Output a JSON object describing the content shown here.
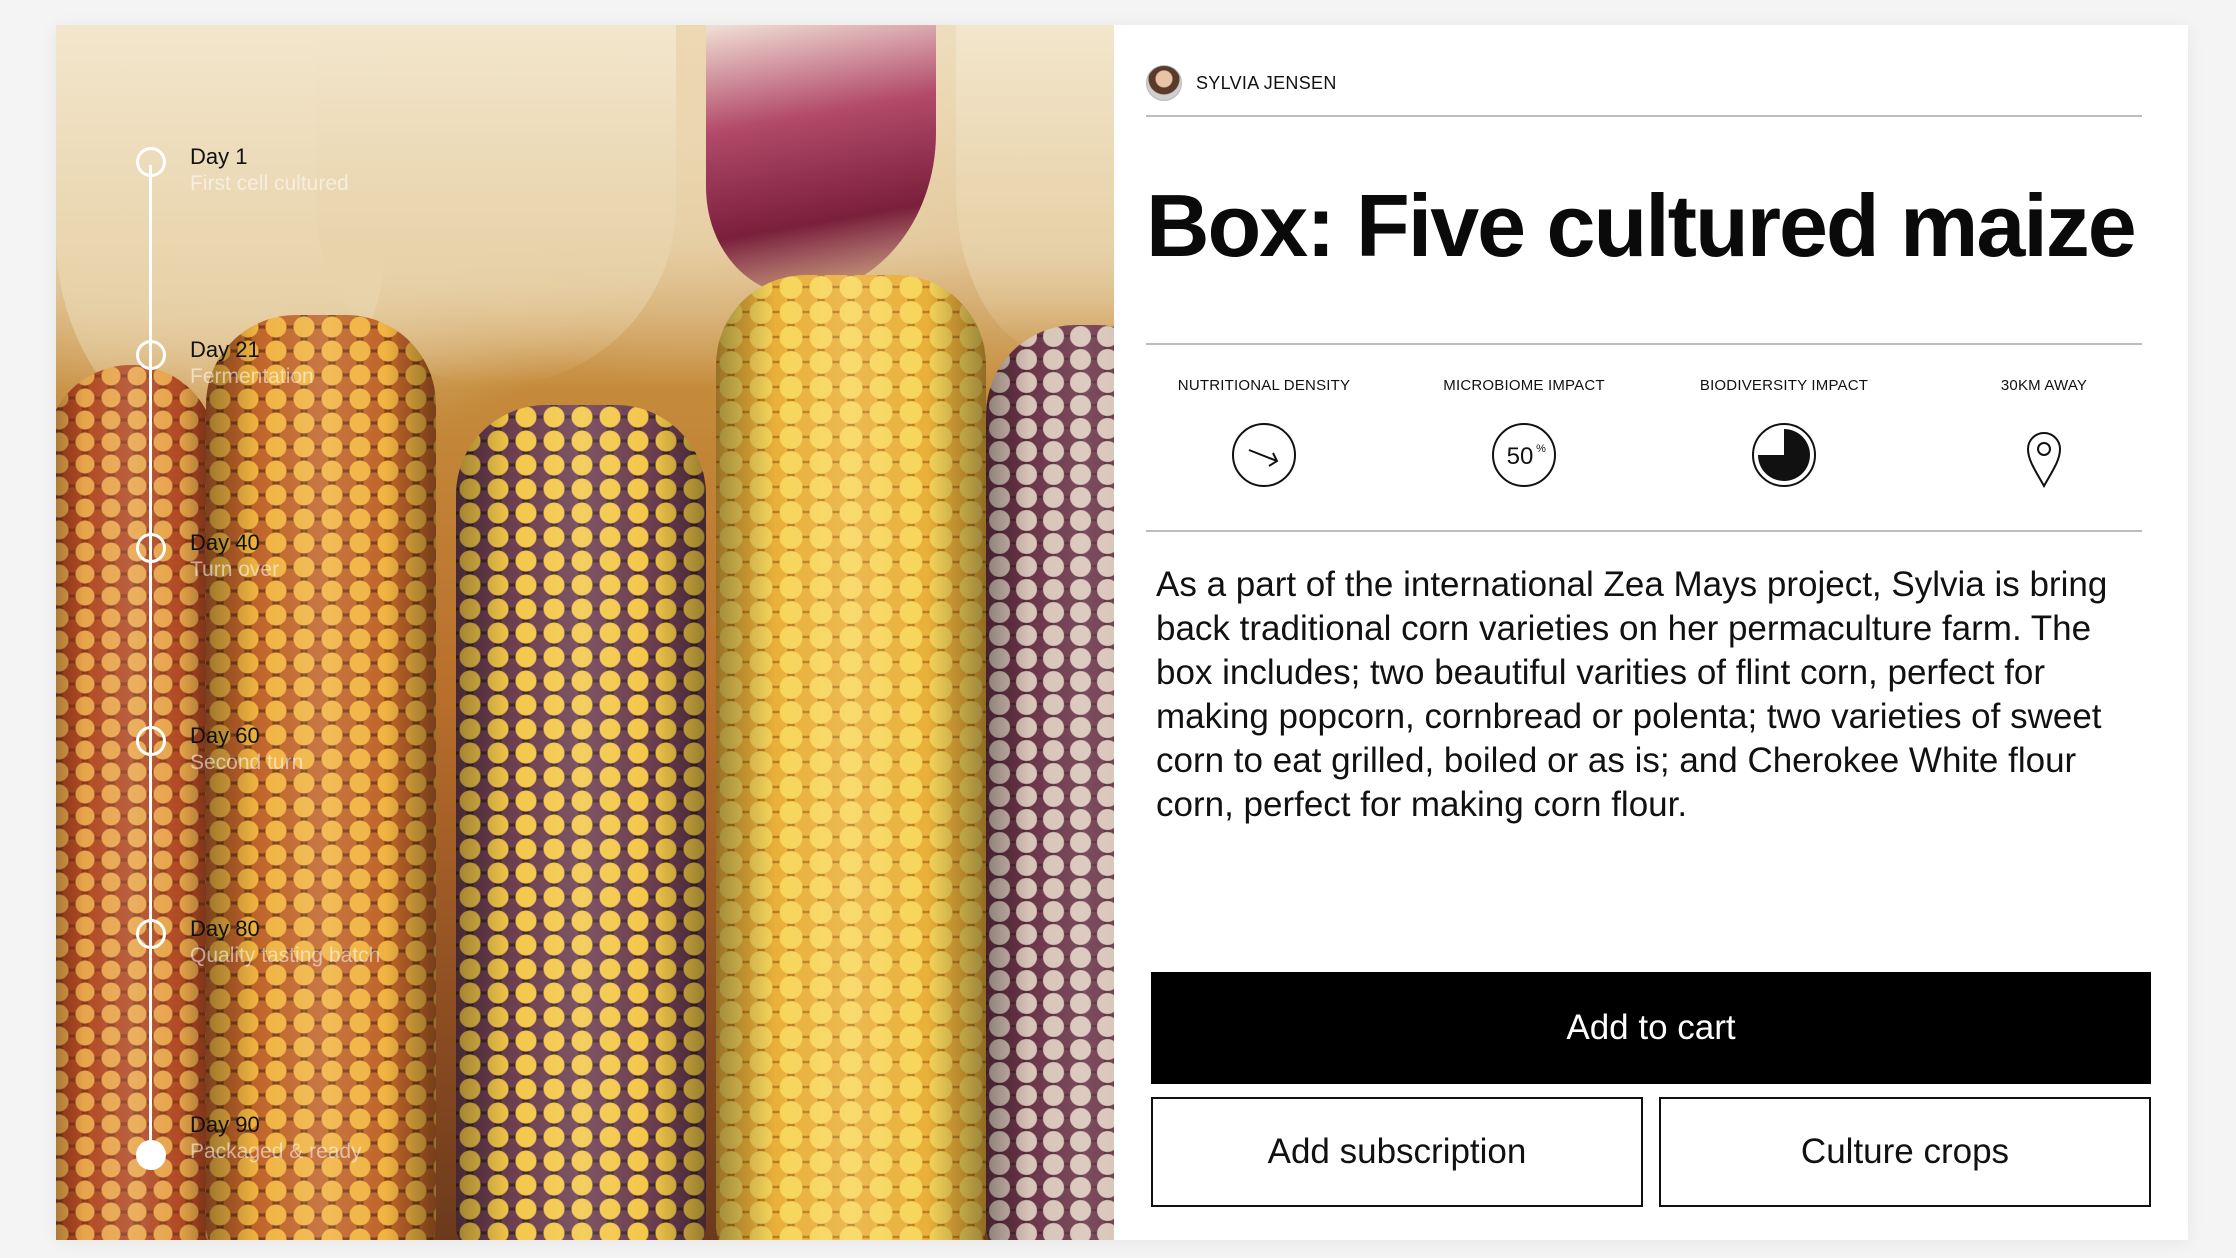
{
  "author": {
    "name": "SYLVIA JENSEN"
  },
  "product": {
    "title": "Box: Five cultured maize"
  },
  "metrics": [
    {
      "label": "NUTRITIONAL DENSITY",
      "icon": "arrow-right-circle-icon"
    },
    {
      "label": "MICROBIOME IMPACT",
      "icon": "percent-circle-icon",
      "value": "50",
      "unit": "%"
    },
    {
      "label": "BIODIVERSITY IMPACT",
      "icon": "pie-gauge-icon",
      "fill": 0.75
    },
    {
      "label": "30KM AWAY",
      "icon": "location-pin-icon"
    }
  ],
  "description": "As a part of the international Zea Mays project, Sylvia is bring back traditional corn varieties on her permaculture farm. The box includes; two beautiful varities of flint corn, perfect for making popcorn, cornbread or polenta; two varieties of sweet corn to eat grilled, boiled or as is; and Cherokee White flour corn, perfect for making corn flour.",
  "timeline": [
    {
      "day": "Day 1",
      "desc": "First cell cultured"
    },
    {
      "day": "Day 21",
      "desc": "Fermentation"
    },
    {
      "day": "Day 40",
      "desc": "Turn over"
    },
    {
      "day": "Day 60",
      "desc": "Second turn"
    },
    {
      "day": "Day 80",
      "desc": "Quality tasting batch"
    },
    {
      "day": "Day 90",
      "desc": "Packaged & ready"
    }
  ],
  "actions": {
    "add_to_cart": "Add to cart",
    "add_subscription": "Add subscription",
    "culture_crops": "Culture crops"
  },
  "colors": {
    "primary": "#000000",
    "background": "#ffffff",
    "rule": "#bdbdbd"
  }
}
